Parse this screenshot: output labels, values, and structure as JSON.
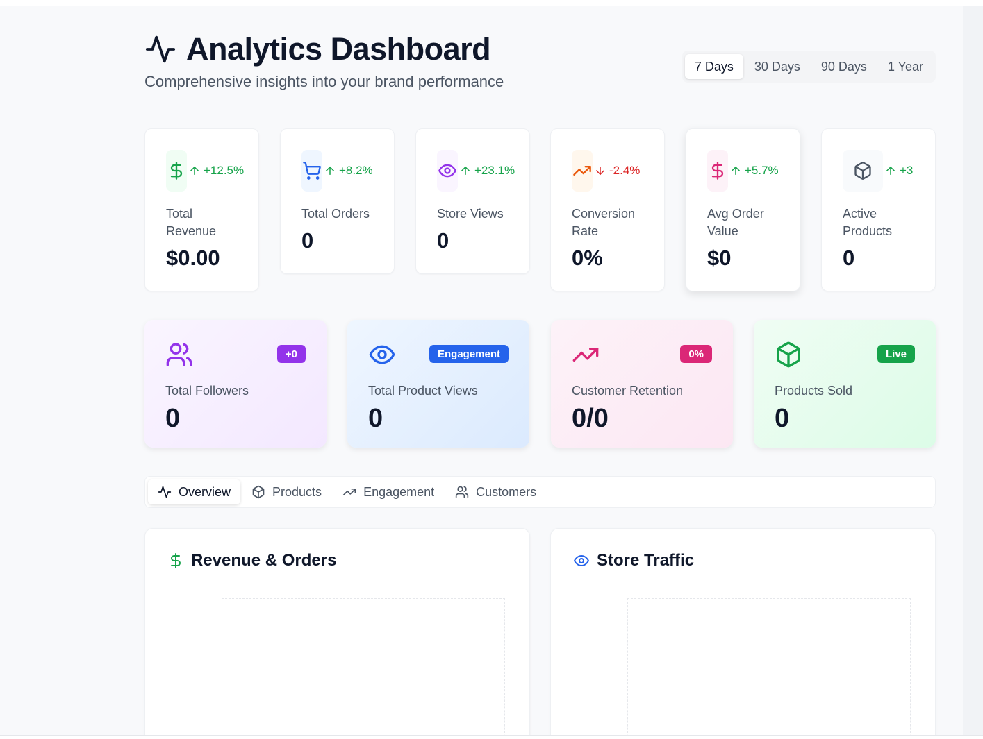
{
  "header": {
    "title": "Analytics Dashboard",
    "subtitle": "Comprehensive insights into your brand performance",
    "icon": "activity-icon"
  },
  "time_range": {
    "options": [
      "7 Days",
      "30 Days",
      "90 Days",
      "1 Year"
    ],
    "selected": "7 Days"
  },
  "stats": [
    {
      "label": "Total Revenue",
      "value": "$0.00",
      "trend": "+12.5%",
      "direction": "up",
      "icon": "dollar-icon",
      "color": "#16a34a"
    },
    {
      "label": "Total Orders",
      "value": "0",
      "trend": "+8.2%",
      "direction": "up",
      "icon": "cart-icon",
      "color": "#2563eb"
    },
    {
      "label": "Store Views",
      "value": "0",
      "trend": "+23.1%",
      "direction": "up",
      "icon": "eye-icon",
      "color": "#9333ea"
    },
    {
      "label": "Conversion Rate",
      "value": "0%",
      "trend": "-2.4%",
      "direction": "down",
      "icon": "trending-up-icon",
      "color": "#ea580c"
    },
    {
      "label": "Avg Order Value",
      "value": "$0",
      "trend": "+5.7%",
      "direction": "up",
      "icon": "dollar-icon",
      "color": "#db2777"
    },
    {
      "label": "Active Products",
      "value": "0",
      "trend": "+3",
      "direction": "up",
      "icon": "package-icon",
      "color": "#4b5563"
    }
  ],
  "cards": [
    {
      "label": "Total Followers",
      "value": "0",
      "badge": "+0",
      "badge_color": "#9333ea",
      "icon": "users-icon",
      "color": "#9333ea"
    },
    {
      "label": "Total Product Views",
      "value": "0",
      "badge": "Engagement",
      "badge_color": "#2563eb",
      "icon": "eye-icon",
      "color": "#2563eb"
    },
    {
      "label": "Customer Retention",
      "value": "0/0",
      "badge": "0%",
      "badge_color": "#db2777",
      "icon": "trending-up-icon",
      "color": "#db2777"
    },
    {
      "label": "Products Sold",
      "value": "0",
      "badge": "Live",
      "badge_color": "#16a34a",
      "icon": "package-icon",
      "color": "#16a34a"
    }
  ],
  "tabs": [
    {
      "label": "Overview",
      "icon": "activity-icon",
      "active": true
    },
    {
      "label": "Products",
      "icon": "package-icon",
      "active": false
    },
    {
      "label": "Engagement",
      "icon": "trending-up-icon",
      "active": false
    },
    {
      "label": "Customers",
      "icon": "users-icon",
      "active": false
    }
  ],
  "panels": [
    {
      "title": "Revenue & Orders",
      "icon": "dollar-icon",
      "color": "#16a34a"
    },
    {
      "title": "Store Traffic",
      "icon": "eye-icon",
      "color": "#2563eb"
    }
  ]
}
